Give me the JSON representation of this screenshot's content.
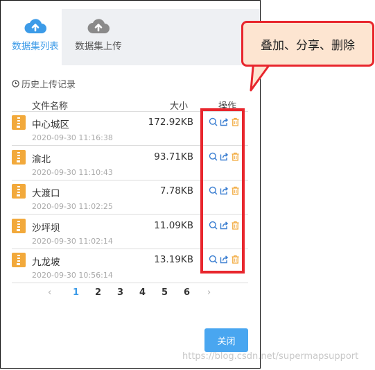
{
  "tabs": [
    {
      "label": "数据集列表",
      "icon": "cloud-upload-icon",
      "active": true
    },
    {
      "label": "数据集上传",
      "icon": "cloud-upload-icon",
      "active": false
    }
  ],
  "history_title": "历史上传记录",
  "table": {
    "headers": {
      "name": "文件名称",
      "size": "大小",
      "ops": "操作"
    },
    "rows": [
      {
        "name": "中心城区",
        "date": "2020-09-30 11:16:38",
        "size": "172.92KB"
      },
      {
        "name": "渝北",
        "date": "2020-09-30 11:10:43",
        "size": "93.71KB"
      },
      {
        "name": "大渡口",
        "date": "2020-09-30 11:02:25",
        "size": "7.78KB"
      },
      {
        "name": "沙坪坝",
        "date": "2020-09-30 11:02:14",
        "size": "11.09KB"
      },
      {
        "name": "九龙坡",
        "date": "2020-09-30 10:56:14",
        "size": "13.19KB"
      }
    ]
  },
  "pagination": {
    "prev": "‹",
    "pages": [
      "1",
      "2",
      "3",
      "4",
      "5",
      "6"
    ],
    "current": "1",
    "next": "›"
  },
  "close_label": "关闭",
  "callout_text": "叠加、分享、删除",
  "watermark": "https://blog.csdn.net/supermapsupport",
  "colors": {
    "accent": "#3c9be8",
    "zip": "#f2a93b",
    "highlight": "#e8262d",
    "callout_bg": "#fde5d1"
  }
}
